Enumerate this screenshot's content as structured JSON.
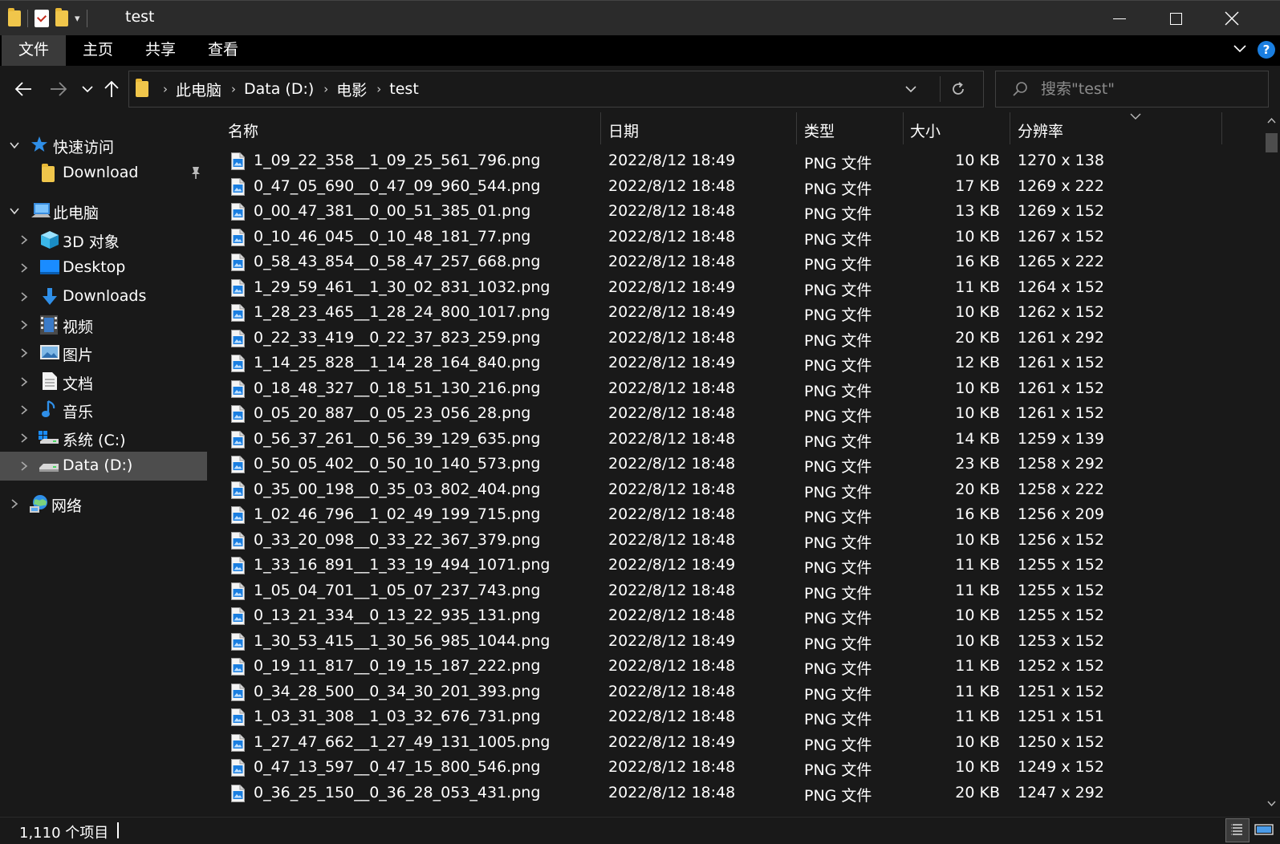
{
  "window": {
    "title": "test",
    "minimize_icon": "minimize-icon",
    "maximize_icon": "maximize-icon",
    "close_icon": "close-icon"
  },
  "ribbon": {
    "tabs": [
      {
        "label": "文件",
        "active": true
      },
      {
        "label": "主页",
        "active": false
      },
      {
        "label": "共享",
        "active": false
      },
      {
        "label": "查看",
        "active": false
      }
    ],
    "help": "?"
  },
  "address": {
    "crumbs": [
      "此电脑",
      "Data (D:)",
      "电影",
      "test"
    ]
  },
  "search": {
    "placeholder": "搜索\"test\""
  },
  "nav": {
    "items": [
      {
        "label": "快速访问",
        "icon": "star-icon",
        "level": 0,
        "expanded": true
      },
      {
        "label": "Download",
        "icon": "folder-icon",
        "level": 1,
        "pinned": true
      },
      {
        "label": "此电脑",
        "icon": "computer-icon",
        "level": 0,
        "expanded": true
      },
      {
        "label": "3D 对象",
        "icon": "cube-3d-icon",
        "level": 1
      },
      {
        "label": "Desktop",
        "icon": "desktop-icon",
        "level": 1
      },
      {
        "label": "Downloads",
        "icon": "download-arrow-icon",
        "level": 1
      },
      {
        "label": "视频",
        "icon": "video-icon",
        "level": 1
      },
      {
        "label": "图片",
        "icon": "pictures-icon",
        "level": 1
      },
      {
        "label": "文档",
        "icon": "document-icon",
        "level": 1
      },
      {
        "label": "音乐",
        "icon": "music-icon",
        "level": 1
      },
      {
        "label": "系统 (C:)",
        "icon": "system-drive-icon",
        "level": 1
      },
      {
        "label": "Data (D:)",
        "icon": "drive-icon",
        "level": 1,
        "selected": true
      },
      {
        "label": "网络",
        "icon": "network-icon",
        "level": 0
      }
    ]
  },
  "columns": {
    "name": "名称",
    "date": "日期",
    "type": "类型",
    "size": "大小",
    "resolution": "分辨率"
  },
  "files": [
    {
      "name": "1_09_22_358__1_09_25_561_796.png",
      "date": "2022/8/12 18:49",
      "type": "PNG 文件",
      "size": "10 KB",
      "res": "1270 x 138"
    },
    {
      "name": "0_47_05_690__0_47_09_960_544.png",
      "date": "2022/8/12 18:48",
      "type": "PNG 文件",
      "size": "17 KB",
      "res": "1269 x 222"
    },
    {
      "name": "0_00_47_381__0_00_51_385_01.png",
      "date": "2022/8/12 18:48",
      "type": "PNG 文件",
      "size": "13 KB",
      "res": "1269 x 152"
    },
    {
      "name": "0_10_46_045__0_10_48_181_77.png",
      "date": "2022/8/12 18:48",
      "type": "PNG 文件",
      "size": "10 KB",
      "res": "1267 x 152"
    },
    {
      "name": "0_58_43_854__0_58_47_257_668.png",
      "date": "2022/8/12 18:48",
      "type": "PNG 文件",
      "size": "16 KB",
      "res": "1265 x 222"
    },
    {
      "name": "1_29_59_461__1_30_02_831_1032.png",
      "date": "2022/8/12 18:49",
      "type": "PNG 文件",
      "size": "11 KB",
      "res": "1264 x 152"
    },
    {
      "name": "1_28_23_465__1_28_24_800_1017.png",
      "date": "2022/8/12 18:49",
      "type": "PNG 文件",
      "size": "10 KB",
      "res": "1262 x 152"
    },
    {
      "name": "0_22_33_419__0_22_37_823_259.png",
      "date": "2022/8/12 18:48",
      "type": "PNG 文件",
      "size": "20 KB",
      "res": "1261 x 292"
    },
    {
      "name": "1_14_25_828__1_14_28_164_840.png",
      "date": "2022/8/12 18:49",
      "type": "PNG 文件",
      "size": "12 KB",
      "res": "1261 x 152"
    },
    {
      "name": "0_18_48_327__0_18_51_130_216.png",
      "date": "2022/8/12 18:48",
      "type": "PNG 文件",
      "size": "10 KB",
      "res": "1261 x 152"
    },
    {
      "name": "0_05_20_887__0_05_23_056_28.png",
      "date": "2022/8/12 18:48",
      "type": "PNG 文件",
      "size": "10 KB",
      "res": "1261 x 152"
    },
    {
      "name": "0_56_37_261__0_56_39_129_635.png",
      "date": "2022/8/12 18:48",
      "type": "PNG 文件",
      "size": "14 KB",
      "res": "1259 x 139"
    },
    {
      "name": "0_50_05_402__0_50_10_140_573.png",
      "date": "2022/8/12 18:48",
      "type": "PNG 文件",
      "size": "23 KB",
      "res": "1258 x 292"
    },
    {
      "name": "0_35_00_198__0_35_03_802_404.png",
      "date": "2022/8/12 18:48",
      "type": "PNG 文件",
      "size": "20 KB",
      "res": "1258 x 222"
    },
    {
      "name": "1_02_46_796__1_02_49_199_715.png",
      "date": "2022/8/12 18:48",
      "type": "PNG 文件",
      "size": "16 KB",
      "res": "1256 x 209"
    },
    {
      "name": "0_33_20_098__0_33_22_367_379.png",
      "date": "2022/8/12 18:48",
      "type": "PNG 文件",
      "size": "10 KB",
      "res": "1256 x 152"
    },
    {
      "name": "1_33_16_891__1_33_19_494_1071.png",
      "date": "2022/8/12 18:49",
      "type": "PNG 文件",
      "size": "11 KB",
      "res": "1255 x 152"
    },
    {
      "name": "1_05_04_701__1_05_07_237_743.png",
      "date": "2022/8/12 18:48",
      "type": "PNG 文件",
      "size": "11 KB",
      "res": "1255 x 152"
    },
    {
      "name": "0_13_21_334__0_13_22_935_131.png",
      "date": "2022/8/12 18:48",
      "type": "PNG 文件",
      "size": "10 KB",
      "res": "1255 x 152"
    },
    {
      "name": "1_30_53_415__1_30_56_985_1044.png",
      "date": "2022/8/12 18:49",
      "type": "PNG 文件",
      "size": "10 KB",
      "res": "1253 x 152"
    },
    {
      "name": "0_19_11_817__0_19_15_187_222.png",
      "date": "2022/8/12 18:48",
      "type": "PNG 文件",
      "size": "11 KB",
      "res": "1252 x 152"
    },
    {
      "name": "0_34_28_500__0_34_30_201_393.png",
      "date": "2022/8/12 18:48",
      "type": "PNG 文件",
      "size": "11 KB",
      "res": "1251 x 152"
    },
    {
      "name": "1_03_31_308__1_03_32_676_731.png",
      "date": "2022/8/12 18:48",
      "type": "PNG 文件",
      "size": "11 KB",
      "res": "1251 x 151"
    },
    {
      "name": "1_27_47_662__1_27_49_131_1005.png",
      "date": "2022/8/12 18:49",
      "type": "PNG 文件",
      "size": "10 KB",
      "res": "1250 x 152"
    },
    {
      "name": "0_47_13_597__0_47_15_800_546.png",
      "date": "2022/8/12 18:48",
      "type": "PNG 文件",
      "size": "10 KB",
      "res": "1249 x 152"
    },
    {
      "name": "0_36_25_150__0_36_28_053_431.png",
      "date": "2022/8/12 18:48",
      "type": "PNG 文件",
      "size": "20 KB",
      "res": "1247 x 292"
    }
  ],
  "status": {
    "count": "1,110 个项目"
  },
  "colors": {
    "background": "#191919",
    "titlebar": "#2b2b2b",
    "ribbon": "#000000",
    "selected": "#4d4d4d",
    "accent": "#1a7ee0",
    "folder": "#f0c64b"
  }
}
